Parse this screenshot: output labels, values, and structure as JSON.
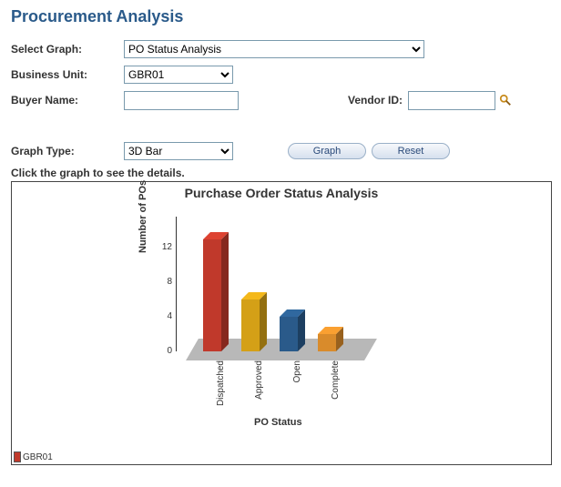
{
  "page": {
    "title": "Procurement Analysis"
  },
  "form": {
    "select_graph_label": "Select Graph:",
    "select_graph_value": "PO Status Analysis",
    "business_unit_label": "Business Unit:",
    "business_unit_value": "GBR01",
    "buyer_name_label": "Buyer Name:",
    "buyer_name_value": "",
    "vendor_id_label": "Vendor ID:",
    "vendor_id_value": "",
    "graph_type_label": "Graph Type:",
    "graph_type_value": "3D Bar",
    "graph_button": "Graph",
    "reset_button": "Reset"
  },
  "hint": "Click the graph to see the details.",
  "chart": {
    "title": "Purchase Order Status Analysis",
    "ylabel": "Number of POs",
    "xlabel": "PO Status",
    "legend": "GBR01",
    "ticks": {
      "t0": "0",
      "t4": "4",
      "t8": "8",
      "t12": "12"
    },
    "cats": {
      "c0": "Dispatched",
      "c1": "Approved",
      "c2": "Open",
      "c3": "Complete"
    }
  },
  "chart_data": {
    "type": "bar",
    "title": "Purchase Order Status Analysis",
    "xlabel": "PO Status",
    "ylabel": "Number of POs",
    "ylim": [
      0,
      14
    ],
    "categories": [
      "Dispatched",
      "Approved",
      "Open",
      "Complete"
    ],
    "series": [
      {
        "name": "GBR01",
        "values": [
          13,
          6,
          4,
          2
        ]
      }
    ],
    "colors": [
      "#c0392b",
      "#d4a017",
      "#2a5a8a",
      "#d98b2b"
    ]
  }
}
